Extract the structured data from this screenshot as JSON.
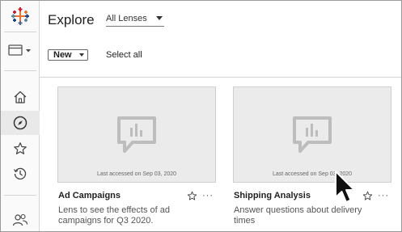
{
  "header": {
    "title": "Explore",
    "lens_filter": "All Lenses"
  },
  "toolbar": {
    "new_label": "New",
    "select_all_label": "Select all"
  },
  "sidebar": {
    "items": [
      {
        "name": "home",
        "icon": "home-icon"
      },
      {
        "name": "explore",
        "icon": "compass-icon",
        "active": true
      },
      {
        "name": "favorites",
        "icon": "star-icon"
      },
      {
        "name": "recents",
        "icon": "history-icon"
      },
      {
        "name": "users",
        "icon": "users-icon"
      }
    ]
  },
  "cards": [
    {
      "name": "Ad Campaigns",
      "description": "Lens to see the effects of ad campaigns for Q3 2020.",
      "last_accessed": "Last accessed on Sep 03, 2020"
    },
    {
      "name": "Shipping Analysis",
      "description": "Answer questions about delivery times",
      "last_accessed": "Last accessed on Sep 03, 2020"
    }
  ],
  "colors": {
    "logo": [
      "#e8762d",
      "#c72035",
      "#5b6591",
      "#59879b",
      "#1f457e"
    ],
    "thumb_bg": "#ebebeb",
    "placeholder_icon": "#bdbdbd"
  }
}
